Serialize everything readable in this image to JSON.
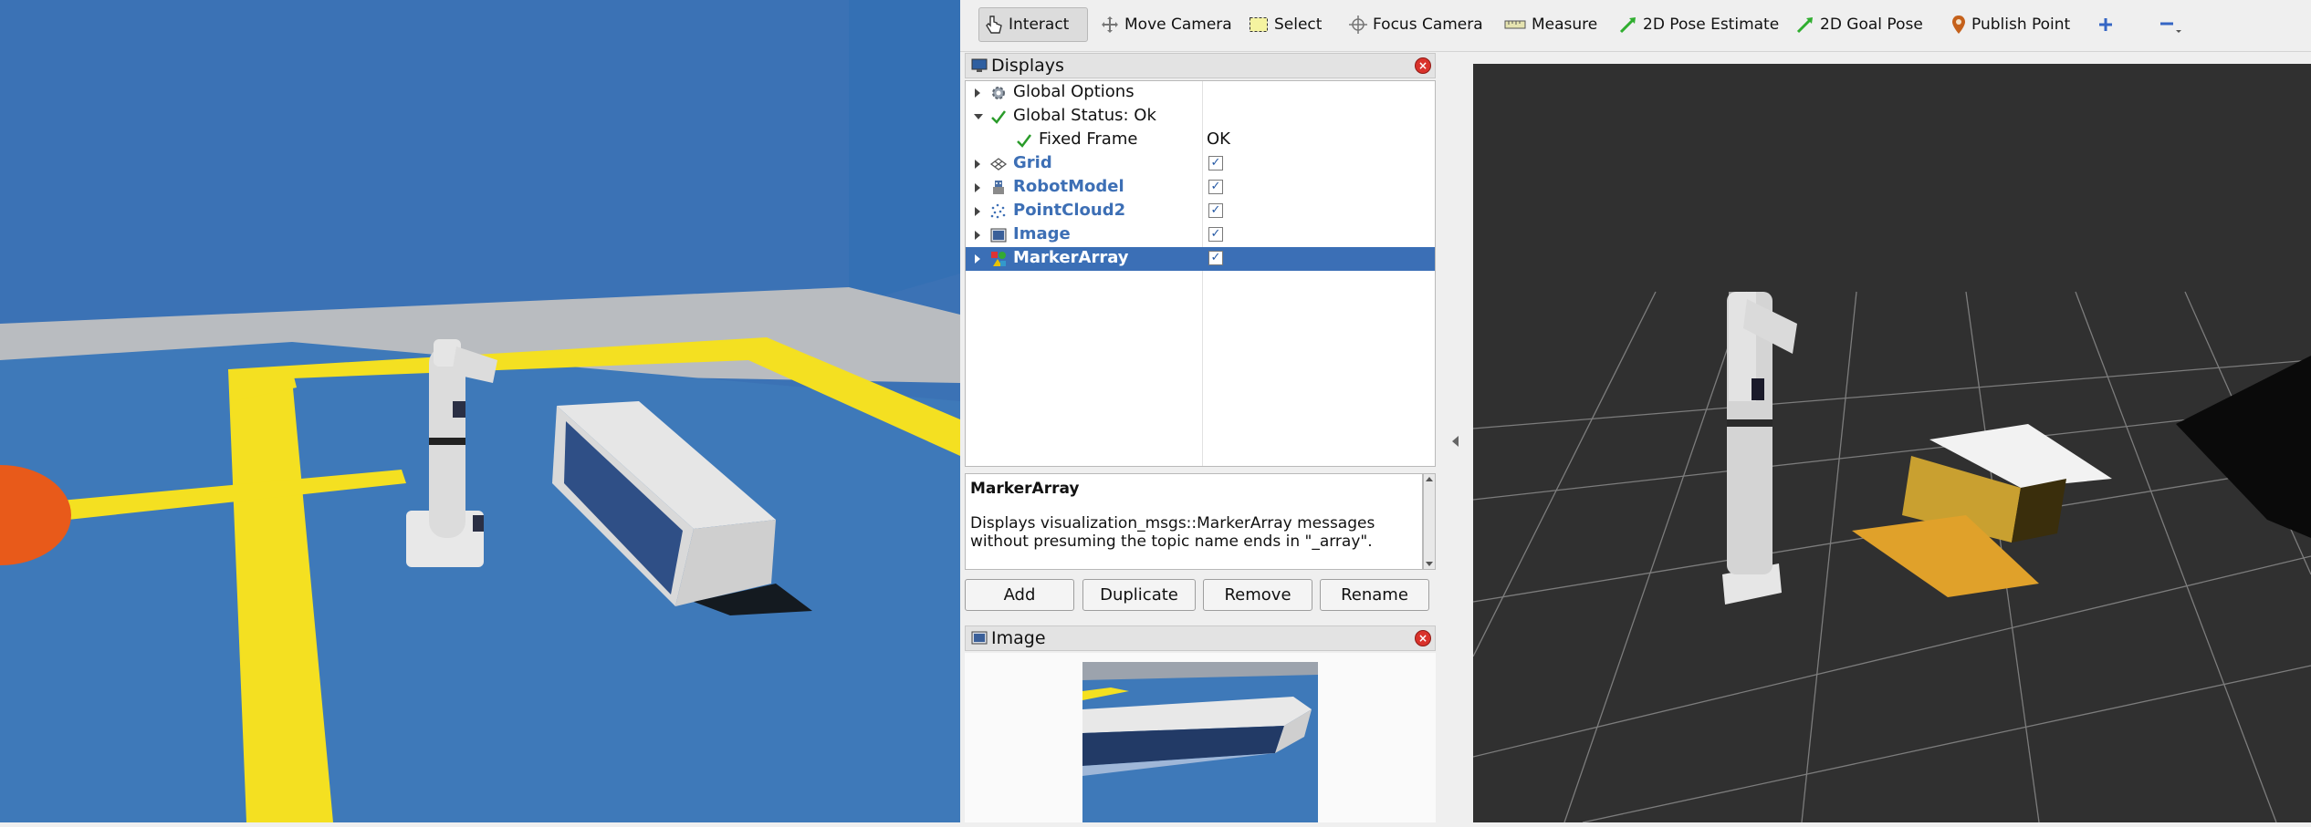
{
  "toolbar": {
    "tools": [
      {
        "label": "Interact",
        "icon": "hand-pointer-icon",
        "active": true
      },
      {
        "label": "Move Camera",
        "icon": "move-arrows-icon"
      },
      {
        "label": "Select",
        "icon": "select-rect-icon"
      },
      {
        "label": "Focus Camera",
        "icon": "crosshair-icon"
      },
      {
        "label": "Measure",
        "icon": "ruler-icon"
      },
      {
        "label": "2D Pose Estimate",
        "icon": "green-arrow-icon"
      },
      {
        "label": "2D Goal Pose",
        "icon": "green-arrow-icon"
      },
      {
        "label": "Publish Point",
        "icon": "map-pin-icon"
      }
    ],
    "add_tool_icon": "plus-icon",
    "remove_tool_icon": "minus-icon"
  },
  "displays_panel": {
    "title": "Displays",
    "rows": [
      {
        "label": "Global Options",
        "icon": "gear-icon",
        "expand": "collapsed"
      },
      {
        "label": "Global Status: Ok",
        "icon": "check-icon",
        "expand": "expanded"
      },
      {
        "label": "Fixed Frame",
        "icon": "check-icon",
        "value": "OK",
        "child": true
      },
      {
        "label": "Grid",
        "icon": "grid-icon",
        "checked": true,
        "display": true,
        "expand": "collapsed"
      },
      {
        "label": "RobotModel",
        "icon": "robot-icon",
        "checked": true,
        "display": true,
        "expand": "collapsed"
      },
      {
        "label": "PointCloud2",
        "icon": "pointcloud-icon",
        "checked": true,
        "display": true,
        "expand": "collapsed"
      },
      {
        "label": "Image",
        "icon": "image-icon",
        "checked": true,
        "display": true,
        "expand": "collapsed"
      },
      {
        "label": "MarkerArray",
        "icon": "marker-icon",
        "checked": true,
        "display": true,
        "expand": "collapsed",
        "selected": true
      }
    ],
    "description": {
      "title": "MarkerArray",
      "text_line1": "Displays visualization_msgs::MarkerArray messages",
      "text_line2": "without presuming the topic name ends in \"_array\"."
    },
    "buttons": {
      "add": "Add",
      "duplicate": "Duplicate",
      "remove": "Remove",
      "rename": "Rename"
    }
  },
  "image_panel": {
    "title": "Image"
  },
  "colors": {
    "selection": "#3b6fb6",
    "display_label": "#3d6fb5",
    "floor_blue": "#3d78b8",
    "wall_blue": "#3b72b5",
    "line_yellow": "#f4e021",
    "render_bg": "#303030",
    "marker_orange": "#e0a12a"
  }
}
